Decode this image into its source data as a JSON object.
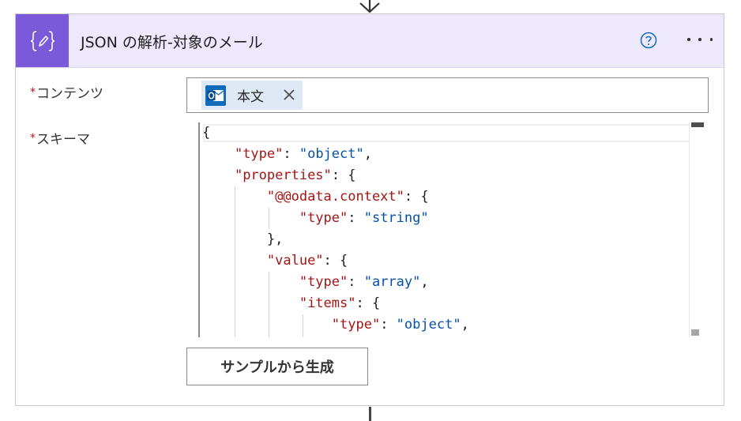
{
  "action": {
    "title": "JSON の解析-対象のメール",
    "icon": "curly-braces-pencil-icon",
    "accent_color": "#7a5ad9",
    "header_bg": "#ede8fb"
  },
  "fields": {
    "content": {
      "required_mark": "*",
      "label": "コンテンツ",
      "token": {
        "icon": "outlook-icon",
        "label": "本文"
      }
    },
    "schema": {
      "required_mark": "*",
      "label": "スキーマ"
    }
  },
  "schema_lines": [
    {
      "indent": 0,
      "parts": [
        {
          "t": "p",
          "v": "{"
        }
      ]
    },
    {
      "indent": 1,
      "parts": [
        {
          "t": "k",
          "v": "\"type\""
        },
        {
          "t": "p",
          "v": ": "
        },
        {
          "t": "s",
          "v": "\"object\""
        },
        {
          "t": "p",
          "v": ","
        }
      ]
    },
    {
      "indent": 1,
      "parts": [
        {
          "t": "k",
          "v": "\"properties\""
        },
        {
          "t": "p",
          "v": ": {"
        }
      ]
    },
    {
      "indent": 2,
      "parts": [
        {
          "t": "k",
          "v": "\"@@odata.context\""
        },
        {
          "t": "p",
          "v": ": {"
        }
      ]
    },
    {
      "indent": 3,
      "parts": [
        {
          "t": "k",
          "v": "\"type\""
        },
        {
          "t": "p",
          "v": ": "
        },
        {
          "t": "s",
          "v": "\"string\""
        }
      ]
    },
    {
      "indent": 2,
      "parts": [
        {
          "t": "p",
          "v": "},"
        }
      ]
    },
    {
      "indent": 2,
      "parts": [
        {
          "t": "k",
          "v": "\"value\""
        },
        {
          "t": "p",
          "v": ": {"
        }
      ]
    },
    {
      "indent": 3,
      "parts": [
        {
          "t": "k",
          "v": "\"type\""
        },
        {
          "t": "p",
          "v": ": "
        },
        {
          "t": "s",
          "v": "\"array\""
        },
        {
          "t": "p",
          "v": ","
        }
      ]
    },
    {
      "indent": 3,
      "parts": [
        {
          "t": "k",
          "v": "\"items\""
        },
        {
          "t": "p",
          "v": ": {"
        }
      ]
    },
    {
      "indent": 4,
      "parts": [
        {
          "t": "k",
          "v": "\"type\""
        },
        {
          "t": "p",
          "v": ": "
        },
        {
          "t": "s",
          "v": "\"object\""
        },
        {
          "t": "p",
          "v": ","
        }
      ]
    }
  ],
  "buttons": {
    "generate_from_sample": "サンプルから生成"
  },
  "colors": {
    "json_key": "#a31515",
    "json_string": "#0451a5",
    "required": "#c50f1f",
    "help": "#0f6cbd"
  }
}
